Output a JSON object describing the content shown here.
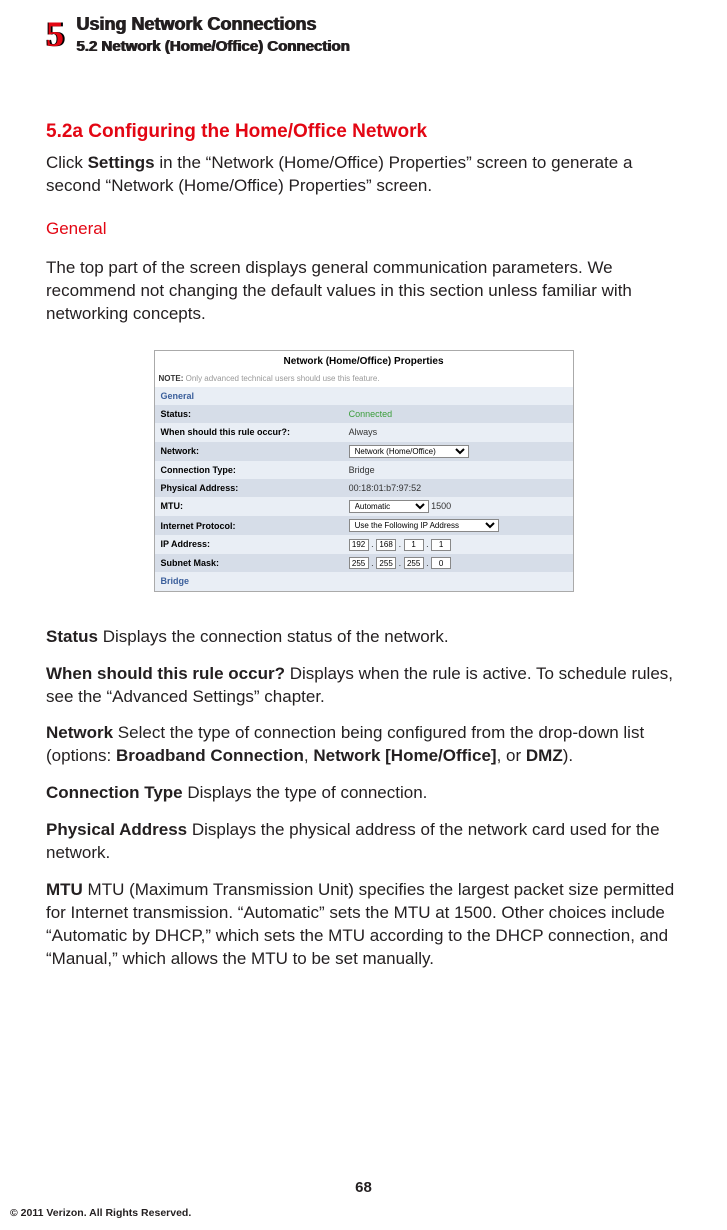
{
  "chapter": {
    "number": "5",
    "title": "Using Network Connections",
    "subtitle": "5.2  Network (Home/Office) Connection"
  },
  "section": {
    "heading": "5.2a  Configuring the Home/Office Network",
    "intro_pre": "Click ",
    "intro_bold": "Settings",
    "intro_post": " in the “Network (Home/Office) Properties” screen to generate a second “Network (Home/Office) Properties” screen."
  },
  "general": {
    "heading": "General",
    "text": "The top part of the screen displays general communication parameters. We recommend not changing the default values in this section unless familiar with networking concepts."
  },
  "props": {
    "title": "Network (Home/Office) Properties",
    "note_label": "NOTE:",
    "note_text": " Only advanced technical users should use this feature.",
    "section1": "General",
    "rows": {
      "status_label": "Status:",
      "status_value": "Connected",
      "rule_label": "When should this rule occur?:",
      "rule_value": "Always",
      "network_label": "Network:",
      "network_value": "Network (Home/Office)",
      "conn_label": "Connection Type:",
      "conn_value": "Bridge",
      "phys_label": "Physical Address:",
      "phys_value": "00:18:01:b7:97:52",
      "mtu_label": "MTU:",
      "mtu_select": "Automatic",
      "mtu_num": "1500",
      "iproto_label": "Internet Protocol:",
      "iproto_value": "Use the Following IP Address",
      "ipaddr_label": "IP Address:",
      "ip1": "192",
      "ip2": "168",
      "ip3": "1",
      "ip4": "1",
      "subnet_label": "Subnet Mask:",
      "sm1": "255",
      "sm2": "255",
      "sm3": "255",
      "sm4": "0"
    },
    "section2": "Bridge"
  },
  "defs": {
    "status_t": "Status",
    "status_d": "  Displays the connection status of the network.",
    "rule_t": "When should this rule occur?",
    "rule_d": "  Displays when the rule is active. To schedule rules, see the “Advanced Settings” chapter.",
    "net_t": "Network",
    "net_d1": "  Select the type of connection being configured from the drop-down list (options: ",
    "net_b1": "Broadband Connection",
    "net_d2": ", ",
    "net_b2": "Network [Home/Office]",
    "net_d3": ", or ",
    "net_b3": "DMZ",
    "net_d4": ").",
    "conn_t": "Connection Type",
    "conn_d": "  Displays the type of connection.",
    "phys_t": "Physical Address",
    "phys_d": "  Displays the physical address of the network card used for the network.",
    "mtu_t": "MTU",
    "mtu_d": "  MTU (Maximum Transmission Unit) specifies the largest packet size permitted for Internet transmission. “Automatic” sets the MTU at 1500. Other choices include “Automatic by DHCP,” which sets the MTU according to the DHCP connection, and “Manual,” which allows the MTU to be set manually."
  },
  "page_number": "68",
  "copyright": "© 2011 Verizon. All Rights Reserved."
}
